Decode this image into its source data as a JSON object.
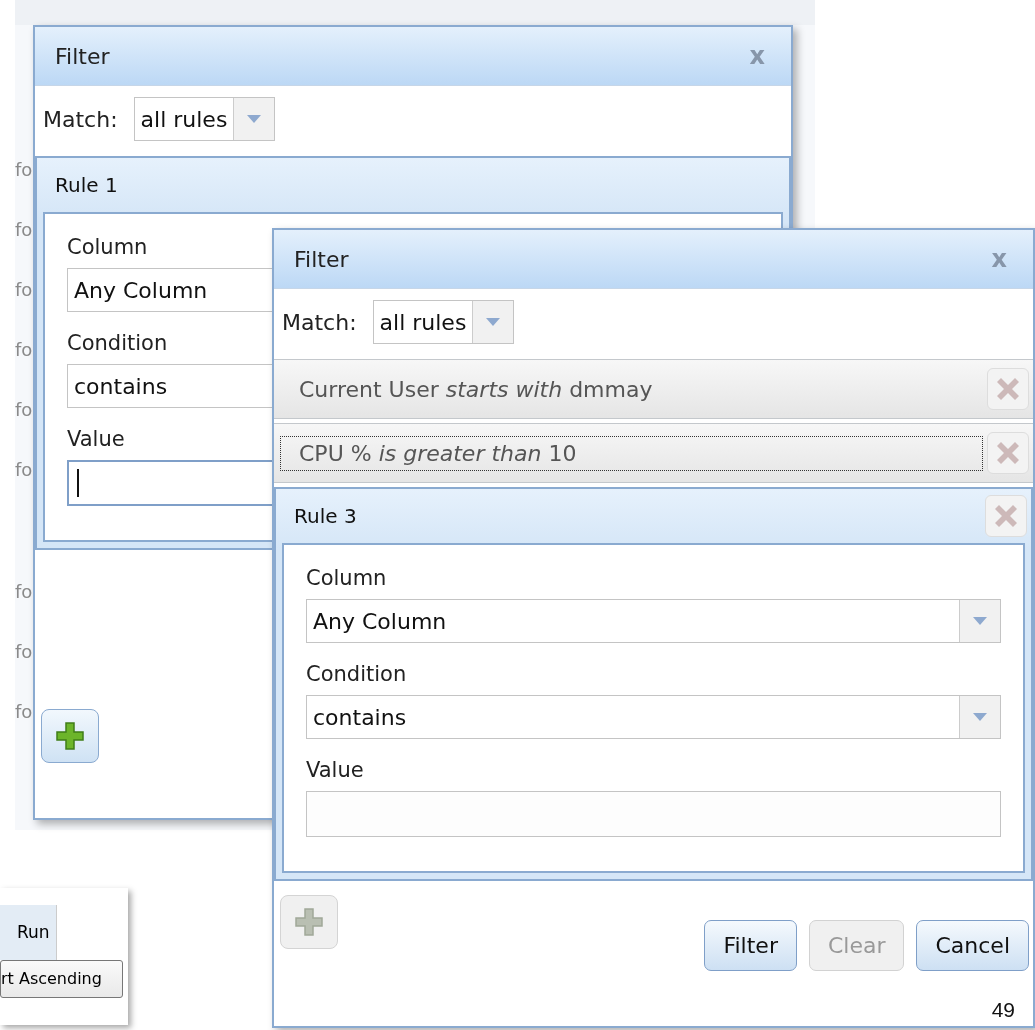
{
  "background_grid": {
    "row_texts": [
      "fo",
      "fo",
      "fo",
      "fo",
      "fo",
      "fo",
      "fo",
      "fo",
      "fo"
    ]
  },
  "column_snippet": {
    "header": "Run",
    "tooltip": "rt Ascending"
  },
  "dialogs": [
    {
      "title": "Filter",
      "close": "x",
      "match_label": "Match:",
      "match_value": "all rules",
      "rules": [
        {
          "kind": "editor",
          "title": "Rule 1",
          "deletable": false,
          "fields": [
            {
              "label": "Column",
              "kind": "text",
              "value": "Any Column"
            },
            {
              "label": "Condition",
              "kind": "text",
              "value": "contains"
            },
            {
              "label": "Value",
              "kind": "input",
              "focused": true
            }
          ]
        }
      ],
      "add_button": {
        "disabled": false
      }
    },
    {
      "title": "Filter",
      "close": "x",
      "match_label": "Match:",
      "match_value": "all rules",
      "rules": [
        {
          "kind": "summary",
          "text": "Current User *starts with* dmmay",
          "focused": false
        },
        {
          "kind": "summary",
          "text": "CPU % *is greater than* 10",
          "focused": true
        },
        {
          "kind": "editor",
          "title": "Rule 3",
          "deletable": true,
          "fields": [
            {
              "label": "Column",
              "kind": "select",
              "value": "Any Column"
            },
            {
              "label": "Condition",
              "kind": "select",
              "value": "contains"
            },
            {
              "label": "Value",
              "kind": "input",
              "focused": false
            }
          ]
        }
      ],
      "add_button": {
        "disabled": true
      },
      "buttons": [
        {
          "label": "Filter",
          "disabled": false
        },
        {
          "label": "Clear",
          "disabled": true
        },
        {
          "label": "Cancel",
          "disabled": false
        }
      ]
    }
  ],
  "page_number": "49"
}
